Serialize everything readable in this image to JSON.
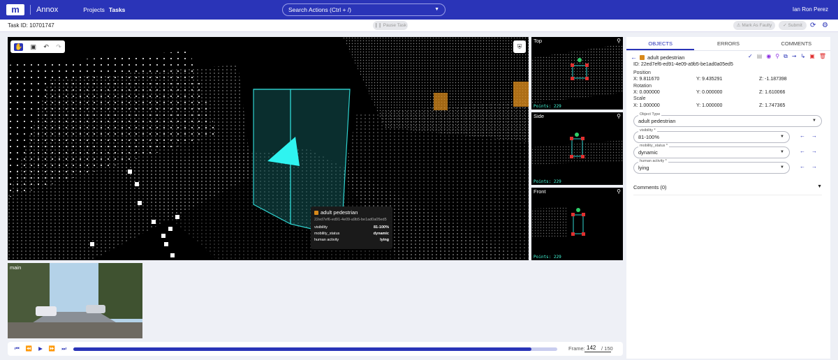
{
  "app": {
    "logo_text": "m",
    "name": "Annox",
    "nav": [
      "Projects",
      "Tasks"
    ],
    "search_placeholder": "Search Actions (Ctrl + /)",
    "user": "Ian Ron Perez",
    "brand_color": "#2a34b8"
  },
  "toolbar": {
    "task_id": "Task ID: 10701747",
    "pause_label": "Pause Task",
    "mark_faulty_label": "Mark As Faulty",
    "submit_label": "Submit"
  },
  "viewport": {
    "tooltip": {
      "title": "adult pedestrian",
      "id": "22ed7ef6-ed91-4e09-a9b5-be1ad0a05ed5",
      "rows": [
        {
          "k": "visibility",
          "v": "81-100%"
        },
        {
          "k": "mobility_status",
          "v": "dynamic"
        },
        {
          "k": "human activity",
          "v": "lying"
        }
      ]
    }
  },
  "sideviews": [
    {
      "title": "Top",
      "points": "Points: 229"
    },
    {
      "title": "Side",
      "points": "Points: 229"
    },
    {
      "title": "Front",
      "points": "Points: 229"
    }
  ],
  "camera": {
    "label": "main"
  },
  "timeline": {
    "progress": 0.947,
    "frame_label": "Frame:",
    "frame": "142",
    "total": "/ 150"
  },
  "panel": {
    "tabs": [
      "OBJECTS",
      "ERRORS",
      "COMMENTS"
    ],
    "object_name": "adult pedestrian",
    "object_id": "ID: 22ed7ef6-ed91-4e09-a9b5-be1ad0a05ed5",
    "position_label": "Position",
    "position": {
      "x": "X: 9.811670",
      "y": "Y: 9.435291",
      "z": "Z: -1.187398"
    },
    "rotation_label": "Rotation",
    "rotation": {
      "x": "X: 0.000000",
      "y": "Y: 0.000000",
      "z": "Z: 1.610066"
    },
    "scale_label": "Scale",
    "scale": {
      "x": "X: 1.000000",
      "y": "Y: 1.000000",
      "z": "Z: 1.747365"
    },
    "object_type_label": "Object Type",
    "object_type": "adult pedestrian",
    "visibility_label": "visibility *",
    "visibility": "81-100%",
    "mobility_label": "mobility_status *",
    "mobility": "dynamic",
    "activity_label": "human activity *",
    "activity": "lying",
    "comments_label": "Comments (0)"
  }
}
